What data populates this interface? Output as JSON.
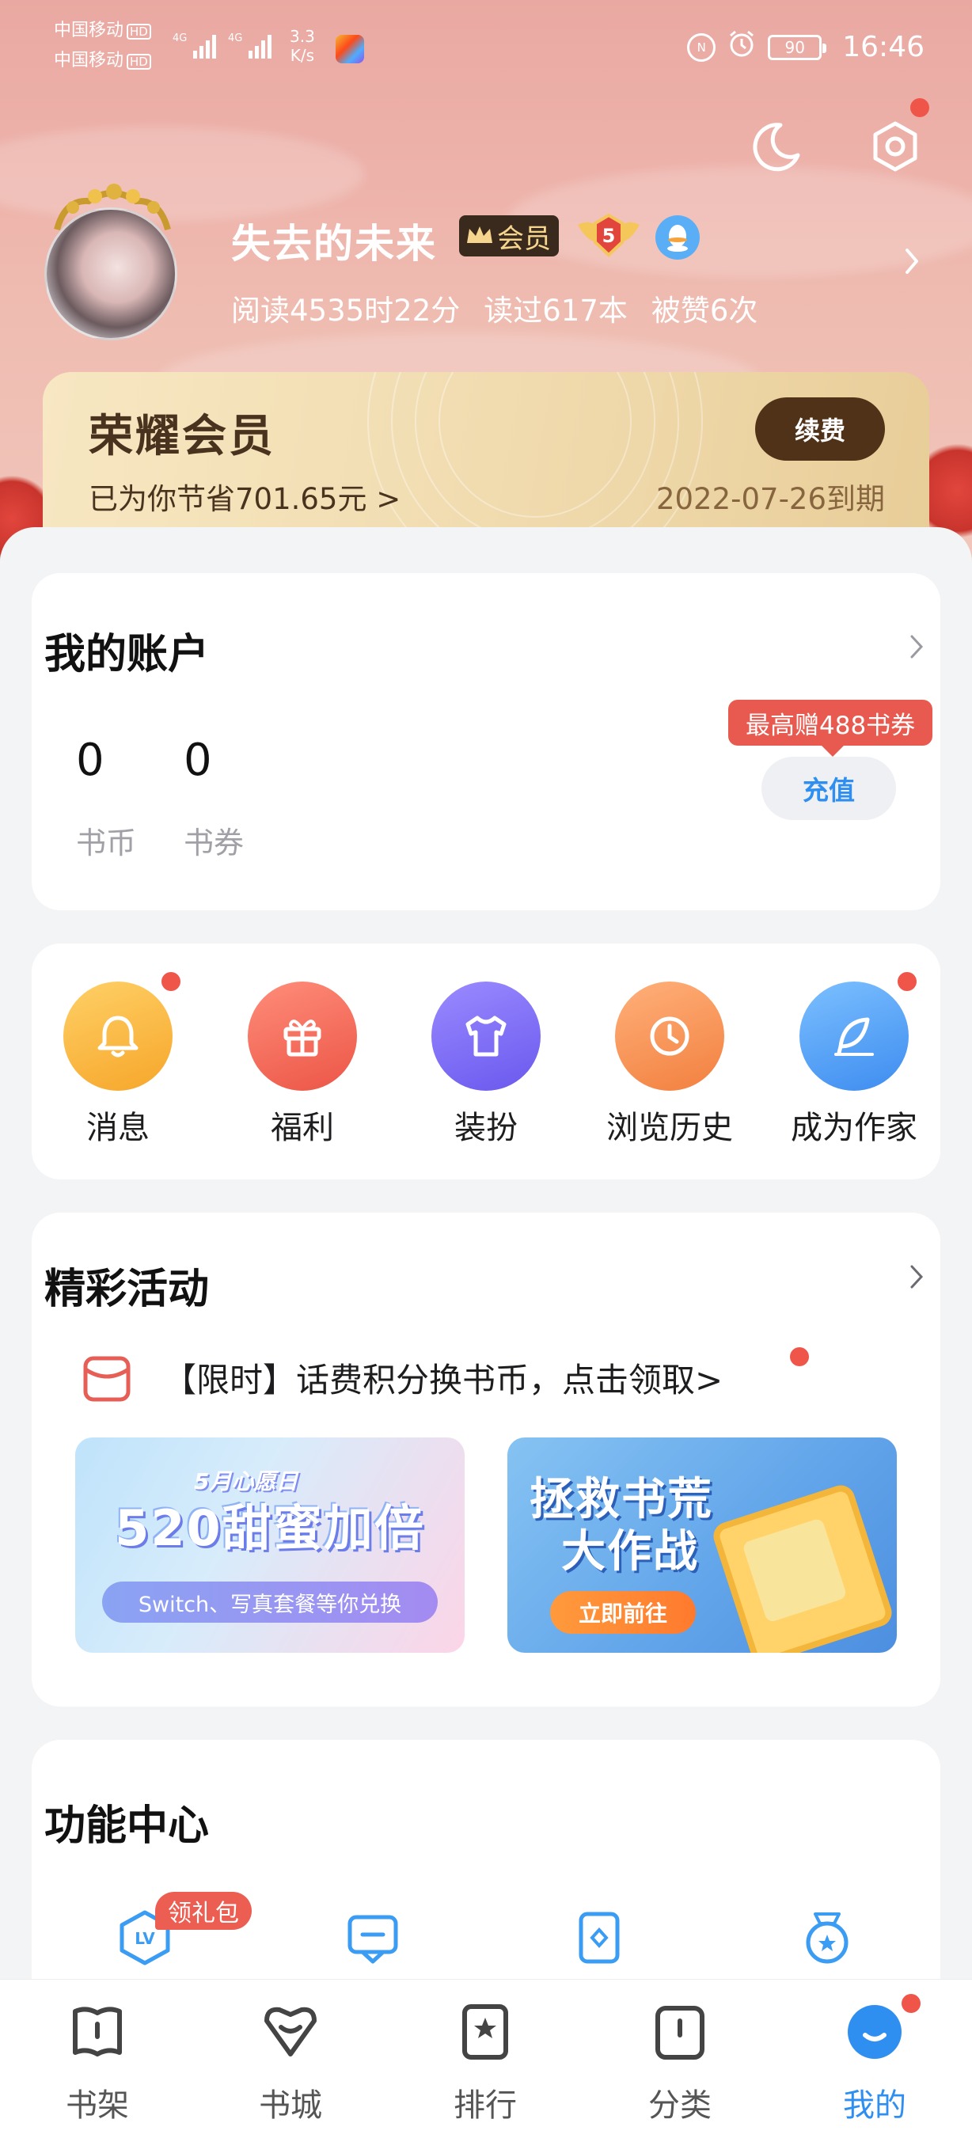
{
  "status_bar": {
    "carrier1": "中国移动",
    "carrier2": "中国移动",
    "hd": "HD",
    "net_type": "4G",
    "speed_value": "3.3",
    "speed_unit": "K/s",
    "battery": "90",
    "time": "16:46"
  },
  "profile": {
    "username": "失去的未来",
    "vip_label": "会员",
    "level": "5",
    "stats": [
      "阅读4535时22分",
      "读过617本",
      "被赞6次"
    ]
  },
  "member_card": {
    "title": "荣耀会员",
    "saved": "已为你节省701.65元 >",
    "expire": "2022-07-26到期",
    "renew_label": "续费"
  },
  "account": {
    "title": "我的账户",
    "coins_value": "0",
    "coins_label": "书币",
    "vouchers_value": "0",
    "vouchers_label": "书券",
    "promo": "最高赠488书券",
    "recharge_label": "充值"
  },
  "quick_icons": [
    {
      "label": "消息",
      "icon": "bell-icon",
      "color": "#f7b23b"
    },
    {
      "label": "福利",
      "icon": "gift-icon",
      "color": "#f06a5b"
    },
    {
      "label": "装扮",
      "icon": "shirt-icon",
      "color": "#7b6cf2"
    },
    {
      "label": "浏览历史",
      "icon": "clock-icon",
      "color": "#f69a5c"
    },
    {
      "label": "成为作家",
      "icon": "feather-icon",
      "color": "#4ea3f6"
    }
  ],
  "activities": {
    "title": "精彩活动",
    "promo_text": "【限时】话费积分换书币，点击领取>",
    "banner1": {
      "tag": "5月心愿日",
      "title": "520甜蜜加倍",
      "subtitle": "Switch、写真套餐等你兑换"
    },
    "banner2": {
      "title_line1": "拯救书荒",
      "title_line2": "大作战",
      "button": "立即前往"
    }
  },
  "function_center": {
    "title": "功能中心",
    "gift_badge": "领礼包",
    "icons": [
      "level-icon",
      "message-icon",
      "card-icon",
      "medal-icon"
    ],
    "level_text": "LV"
  },
  "bottom_nav": [
    {
      "label": "书架",
      "icon": "bookshelf-icon",
      "active": false
    },
    {
      "label": "书城",
      "icon": "bookstore-icon",
      "active": false
    },
    {
      "label": "排行",
      "icon": "ranking-icon",
      "active": false
    },
    {
      "label": "分类",
      "icon": "category-icon",
      "active": false
    },
    {
      "label": "我的",
      "icon": "profile-icon",
      "active": true
    }
  ],
  "colors": {
    "accent": "#2f8ff0",
    "badge_red": "#f0554a",
    "member_text": "#4a331e"
  }
}
